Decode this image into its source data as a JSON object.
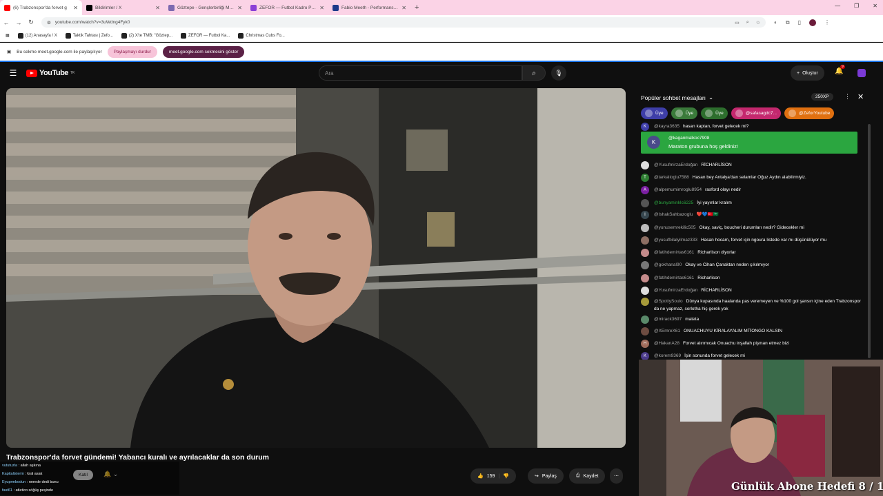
{
  "browser": {
    "tabs": [
      {
        "label": "(6) Trabzonspor'da forvet g",
        "favicon": "youtube-icon",
        "color": "#ff0000",
        "active": true
      },
      {
        "label": "Bildirimler / X",
        "favicon": "x-icon",
        "color": "#000000",
        "active": false
      },
      {
        "label": "Göztepe - Gençlerbirliği Maç Öz",
        "favicon": "flashscore-icon",
        "color": "#7d6ab0",
        "active": false
      },
      {
        "label": "ZEFOR — Futbol Kadro Planları",
        "favicon": "zefor-icon",
        "color": "#8b3fd6",
        "active": false
      },
      {
        "label": "Fabio Meeth - Performans bilgi",
        "favicon": "transfermarkt-icon",
        "color": "#1d3a8a",
        "active": false
      }
    ],
    "url": "youtube.com/watch?v=3uWdng4Fyk0",
    "bookmarks": [
      "(12) Anasayfa / X",
      "Taktik Tahtası | Zefo...",
      "(2) X'te TMB: \"Göztep...",
      "ZEFOR — Futbol Ka...",
      "Christmas Cubs Fo..."
    ],
    "share": {
      "text": "Bu sekme meet.google.com ile paylaşılıyor",
      "stop_label": "Paylaşmayı durdur",
      "show_label": "meet.google.com sekmesini göster"
    }
  },
  "youtube": {
    "logo_text": "YouTube",
    "country": "TR",
    "search_placeholder": "Ara",
    "create_label": "Oluştur",
    "notification_count": "9",
    "video": {
      "title": "Trabzonspor'da forvet gündemi! Yabancı kuralı ve ayrılacaklar da son durum",
      "join_label": "Katıl",
      "like_count": "159",
      "share_label": "Paylaş",
      "save_label": "Kaydet"
    },
    "overlay_chat": [
      {
        "user": "vututuzla",
        "text": "allah aşkına"
      },
      {
        "user": "Kapitalisterm",
        "text": "kral asak"
      },
      {
        "user": "Eyuprmbodun",
        "text": "nerede dedi bunu"
      },
      {
        "user": "fast61",
        "text": "atletico söğüş peşinde"
      }
    ],
    "chat": {
      "header": "Popüler sohbet mesajları",
      "xp": "250XP",
      "chips": [
        {
          "label": "Üye",
          "color": "#3e3ea8"
        },
        {
          "label": "Üye",
          "color": "#3a7a3a"
        },
        {
          "label": "Üye",
          "color": "#2d6e2d"
        },
        {
          "label": "@safasagdc7...",
          "color": "#c4286e"
        },
        {
          "label": "@ZeforYoutube",
          "color": "#e07010"
        }
      ],
      "top_partial": {
        "user": "@kayra3635",
        "text": "hasan kaptan, forvet gelecek mi?"
      },
      "highlight": {
        "initial": "K",
        "user": "@kaganmalkoc7908",
        "text": "Maraton grubuna hoş geldiniz!"
      },
      "messages": [
        {
          "user": "@YusufmirzaErdoğan",
          "text": "RİCHARLİSON",
          "avatar_color": "#dddddd",
          "initial": ""
        },
        {
          "user": "@tarkalioglu7588",
          "text": "Hasan bey Antalya'dan selamlar Oğuz Aydın alabilirmiyiz.",
          "avatar_color": "#2e7d32",
          "initial": "T"
        },
        {
          "user": "@alpemumimroglu8954",
          "text": "rasford olayı nedir",
          "avatar_color": "#7b1fa2",
          "initial": "A"
        },
        {
          "user": "@bunyaminklc6225",
          "text": "İyi yayınlar kralım",
          "avatar_color": "#555555",
          "initial": "",
          "green": true
        },
        {
          "user": "@IshakSahbazoglu",
          "text": "❤️💙🇹🇷🇸🇦",
          "avatar_color": "#37474f",
          "initial": "I"
        },
        {
          "user": "@yunusemrekilic505",
          "text": "Okay, saviç, boucheri durumları nedir? Gidecekler mi",
          "avatar_color": "#bdbdbd",
          "initial": ""
        },
        {
          "user": "@yusufbilalyilmaz333",
          "text": "Hasan hocam, forvet için ngoura listede var mı düşünülüyor mu",
          "avatar_color": "#8d6e63",
          "initial": ""
        },
        {
          "user": "@fatihdemirtas6161",
          "text": "Richarlison diyorlar",
          "avatar_color": "#c48b8b",
          "initial": ""
        },
        {
          "user": "@gokhanal90",
          "text": "Okay ve Cihan Çanaktan neden çıkılmıyor",
          "avatar_color": "#777777",
          "initial": ""
        },
        {
          "user": "@fatihdemirtas6161",
          "text": "Richarlison",
          "avatar_color": "#c48b8b",
          "initial": ""
        },
        {
          "user": "@YusufmirzaErdoğan",
          "text": "RİCHARLİSON",
          "avatar_color": "#dddddd",
          "initial": ""
        },
        {
          "user": "@SpottySoulo",
          "text": "Dünya kupasında haalanda pas veremeyen ve %100 gol şansın içine eden Trabzonspor da ne yapmaz, sorlotha hiç gerek yok",
          "avatar_color": "#a69a3a",
          "initial": ""
        },
        {
          "user": "@mirack3697",
          "text": "mateta",
          "avatar_color": "#5a8a6a",
          "initial": ""
        },
        {
          "user": "@XEmreX61",
          "text": "ONUACHUYU KİRALAYALIM MİTONGO KALSIN",
          "avatar_color": "#6d4c41",
          "initial": ""
        },
        {
          "user": "@HakanA28",
          "text": "Forvet alınmıcak Onuachu inşallah pişman etmez bizi",
          "avatar_color": "#9e6b5a",
          "initial": "H"
        },
        {
          "user": "@korem9369",
          "text": "İşin sonunda forvet gelecek mi",
          "avatar_color": "#4a3a8a",
          "initial": "K"
        }
      ]
    }
  },
  "webcam": {
    "goal_text": "Günlük Abone Hedefi 8 / 15"
  }
}
